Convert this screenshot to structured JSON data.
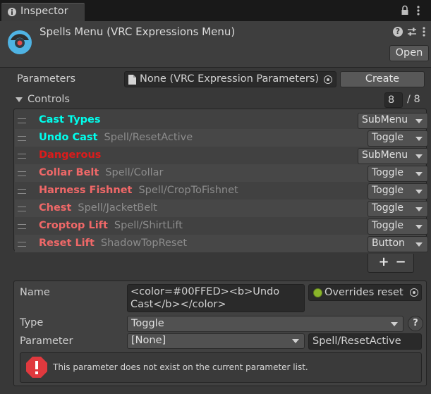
{
  "tab": {
    "icon": "info-icon",
    "title": "Inspector"
  },
  "header": {
    "title": "Spells Menu (VRC Expressions Menu)",
    "open_label": "Open",
    "asset_icon": "expressions-menu-icon"
  },
  "parameters": {
    "label": "Parameters",
    "value": "None (VRC Expression Parameters)",
    "create_label": "Create"
  },
  "controls": {
    "label": "Controls",
    "count": "8",
    "max": "/ 8",
    "add_label": "+",
    "remove_label": "−",
    "items": [
      {
        "name": "Cast Types",
        "param": "",
        "type": "SubMenu",
        "color": "#00FFED"
      },
      {
        "name": "Undo Cast",
        "param": "Spell/ResetActive",
        "type": "Toggle",
        "color": "#00FFED"
      },
      {
        "name": "Dangerous",
        "param": "",
        "type": "SubMenu",
        "color": "#DD1B1B"
      },
      {
        "name": "Collar Belt",
        "param": "Spell/Collar",
        "type": "Toggle",
        "color": "#F06868"
      },
      {
        "name": "Harness Fishnet",
        "param": "Spell/CropToFishnet",
        "type": "Toggle",
        "color": "#F06868"
      },
      {
        "name": "Chest",
        "param": "Spell/JacketBelt",
        "type": "Toggle",
        "color": "#F06868"
      },
      {
        "name": "Croptop Lift",
        "param": "Spell/ShirtLift",
        "type": "Toggle",
        "color": "#F06868"
      },
      {
        "name": "Reset Lift",
        "param": "ShadowTopReset",
        "type": "Button",
        "color": "#F06868"
      }
    ]
  },
  "detail": {
    "name_label": "Name",
    "name_line1": "<color=#00FFED><b>Undo",
    "name_line2": "Cast</b></color>",
    "overrides_label": "Overrides reset",
    "type_label": "Type",
    "type_value": "Toggle",
    "help_label": "?",
    "parameter_label": "Parameter",
    "parameter_value": "[None]",
    "parameter_text": "Spell/ResetActive",
    "warning": "This parameter does not exist on the current parameter list."
  }
}
